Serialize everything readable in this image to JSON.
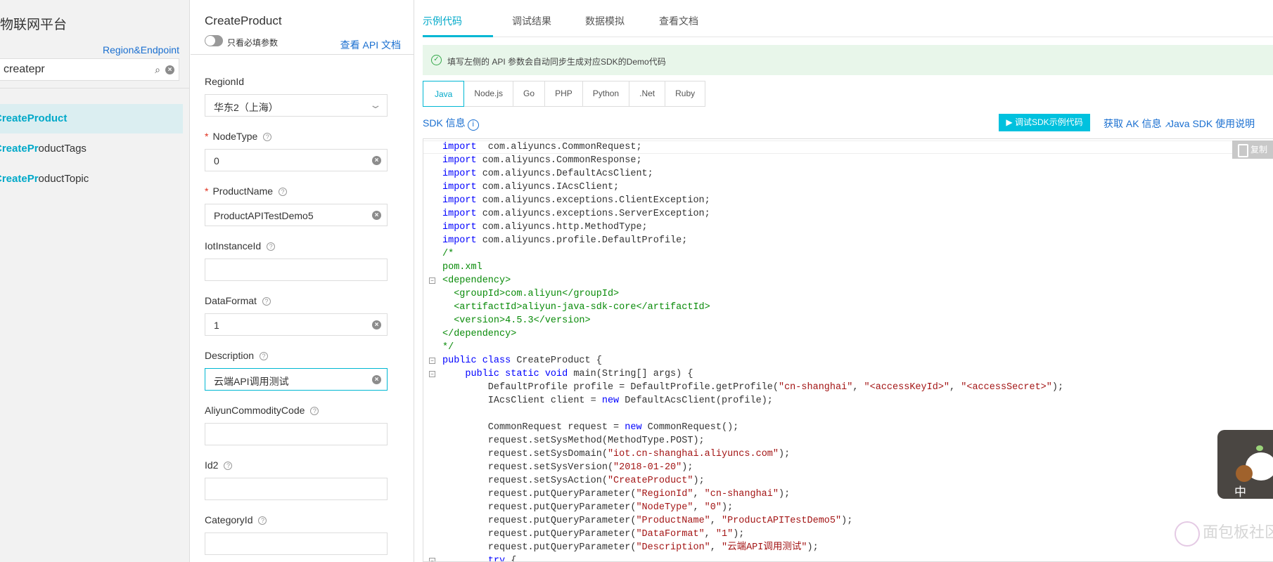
{
  "sidebar": {
    "title": "物联网平台",
    "region_link": "Region&Endpoint",
    "search": {
      "value": "createpr",
      "icons": [
        "search-icon",
        "clear-icon"
      ]
    },
    "items": [
      {
        "highlight": "CreatePr",
        "rest": "oduct",
        "selected": true
      },
      {
        "highlight": "CreatePr",
        "rest": "oductTags",
        "selected": false
      },
      {
        "highlight": "CreatePr",
        "rest": "oductTopic",
        "selected": false
      }
    ]
  },
  "form": {
    "title": "CreateProduct",
    "toggle_label": "只看必填参数",
    "toggle_on": false,
    "api_doc_link": "查看 API 文档",
    "fields": [
      {
        "label": "RegionId",
        "required": false,
        "help": false,
        "type": "select",
        "value": "华东2（上海）"
      },
      {
        "label": "NodeType",
        "required": true,
        "help": true,
        "type": "input",
        "value": "0"
      },
      {
        "label": "ProductName",
        "required": true,
        "help": true,
        "type": "input",
        "value": "ProductAPITestDemo5"
      },
      {
        "label": "IotInstanceId",
        "required": false,
        "help": true,
        "type": "input",
        "value": ""
      },
      {
        "label": "DataFormat",
        "required": false,
        "help": true,
        "type": "input",
        "value": "1"
      },
      {
        "label": "Description",
        "required": false,
        "help": true,
        "type": "input",
        "value": "云端API调用测试",
        "focused": true
      },
      {
        "label": "AliyunCommodityCode",
        "required": false,
        "help": true,
        "type": "input",
        "value": ""
      },
      {
        "label": "Id2",
        "required": false,
        "help": true,
        "type": "input",
        "value": ""
      },
      {
        "label": "CategoryId",
        "required": false,
        "help": true,
        "type": "input",
        "value": ""
      }
    ]
  },
  "main": {
    "tabs": [
      {
        "label": "示例代码",
        "active": true
      },
      {
        "label": "调试结果",
        "active": false
      },
      {
        "label": "数据模拟",
        "active": false
      },
      {
        "label": "查看文档",
        "active": false
      }
    ],
    "banner": "填写左侧的 API 参数会自动同步生成对应SDK的Demo代码",
    "languages": [
      {
        "label": "Java",
        "active": true
      },
      {
        "label": "Node.js"
      },
      {
        "label": "Go"
      },
      {
        "label": "PHP"
      },
      {
        "label": "Python"
      },
      {
        "label": ".Net"
      },
      {
        "label": "Ruby"
      }
    ],
    "sdk_info": "SDK 信息",
    "run_button": "调试SDK示例代码",
    "get_ak": "获取 AK 信息",
    "java_sdk_doc": "Java SDK 使用说明",
    "copy_button": "复制",
    "code": [
      {
        "seg": [
          [
            "kw",
            "import"
          ],
          [
            "",
            "  com.aliyuncs.CommonRequest;"
          ]
        ]
      },
      {
        "seg": [
          [
            "kw",
            "import"
          ],
          [
            "",
            " com.aliyuncs.CommonResponse;"
          ]
        ]
      },
      {
        "seg": [
          [
            "kw",
            "import"
          ],
          [
            "",
            " com.aliyuncs.DefaultAcsClient;"
          ]
        ]
      },
      {
        "seg": [
          [
            "kw",
            "import"
          ],
          [
            "",
            " com.aliyuncs.IAcsClient;"
          ]
        ]
      },
      {
        "seg": [
          [
            "kw",
            "import"
          ],
          [
            "",
            " com.aliyuncs.exceptions.ClientException;"
          ]
        ]
      },
      {
        "seg": [
          [
            "kw",
            "import"
          ],
          [
            "",
            " com.aliyuncs.exceptions.ServerException;"
          ]
        ]
      },
      {
        "seg": [
          [
            "kw",
            "import"
          ],
          [
            "",
            " com.aliyuncs.http.MethodType;"
          ]
        ]
      },
      {
        "seg": [
          [
            "kw",
            "import"
          ],
          [
            "",
            " com.aliyuncs.profile.DefaultProfile;"
          ]
        ]
      },
      {
        "seg": [
          [
            "xml",
            "/*"
          ]
        ]
      },
      {
        "seg": [
          [
            "xml",
            "pom.xml"
          ]
        ]
      },
      {
        "seg": [
          [
            "xml",
            "<dependency>"
          ]
        ],
        "fold": true
      },
      {
        "seg": [
          [
            "xml",
            "  <groupId>com.aliyun</groupId>"
          ]
        ]
      },
      {
        "seg": [
          [
            "xml",
            "  <artifactId>aliyun-java-sdk-core</artifactId>"
          ]
        ]
      },
      {
        "seg": [
          [
            "xml",
            "  <version>4.5.3</version>"
          ]
        ]
      },
      {
        "seg": [
          [
            "xml",
            "</dependency>"
          ]
        ]
      },
      {
        "seg": [
          [
            "xml",
            "*/"
          ]
        ]
      },
      {
        "seg": [
          [
            "kw",
            "public class"
          ],
          [
            "",
            " CreateProduct {"
          ]
        ],
        "fold": true
      },
      {
        "seg": [
          [
            "",
            "    "
          ],
          [
            "kw",
            "public static void"
          ],
          [
            "",
            " main(String[] args) {"
          ]
        ],
        "fold": true
      },
      {
        "seg": [
          [
            "",
            "        DefaultProfile profile = DefaultProfile.getProfile("
          ],
          [
            "str",
            "\"cn-shanghai\""
          ],
          [
            "",
            ", "
          ],
          [
            "str",
            "\"<accessKeyId>\""
          ],
          [
            "",
            ", "
          ],
          [
            "str",
            "\"<accessSecret>\""
          ],
          [
            "",
            ");"
          ]
        ]
      },
      {
        "seg": [
          [
            "",
            "        IAcsClient client = "
          ],
          [
            "kw",
            "new"
          ],
          [
            "",
            " DefaultAcsClient(profile);"
          ]
        ]
      },
      {
        "seg": [
          [
            "",
            ""
          ]
        ]
      },
      {
        "seg": [
          [
            "",
            "        CommonRequest request = "
          ],
          [
            "kw",
            "new"
          ],
          [
            "",
            " CommonRequest();"
          ]
        ]
      },
      {
        "seg": [
          [
            "",
            "        request.setSysMethod(MethodType.POST);"
          ]
        ]
      },
      {
        "seg": [
          [
            "",
            "        request.setSysDomain("
          ],
          [
            "str",
            "\"iot.cn-shanghai.aliyuncs.com\""
          ],
          [
            "",
            ");"
          ]
        ]
      },
      {
        "seg": [
          [
            "",
            "        request.setSysVersion("
          ],
          [
            "str",
            "\"2018-01-20\""
          ],
          [
            "",
            ");"
          ]
        ]
      },
      {
        "seg": [
          [
            "",
            "        request.setSysAction("
          ],
          [
            "str",
            "\"CreateProduct\""
          ],
          [
            "",
            ");"
          ]
        ]
      },
      {
        "seg": [
          [
            "",
            "        request.putQueryParameter("
          ],
          [
            "str",
            "\"RegionId\""
          ],
          [
            "",
            ", "
          ],
          [
            "str",
            "\"cn-shanghai\""
          ],
          [
            "",
            ");"
          ]
        ]
      },
      {
        "seg": [
          [
            "",
            "        request.putQueryParameter("
          ],
          [
            "str",
            "\"NodeType\""
          ],
          [
            "",
            ", "
          ],
          [
            "str",
            "\"0\""
          ],
          [
            "",
            ");"
          ]
        ]
      },
      {
        "seg": [
          [
            "",
            "        request.putQueryParameter("
          ],
          [
            "str",
            "\"ProductName\""
          ],
          [
            "",
            ", "
          ],
          [
            "str",
            "\"ProductAPITestDemo5\""
          ],
          [
            "",
            ");"
          ]
        ]
      },
      {
        "seg": [
          [
            "",
            "        request.putQueryParameter("
          ],
          [
            "str",
            "\"DataFormat\""
          ],
          [
            "",
            ", "
          ],
          [
            "str",
            "\"1\""
          ],
          [
            "",
            ");"
          ]
        ]
      },
      {
        "seg": [
          [
            "",
            "        request.putQueryParameter("
          ],
          [
            "str",
            "\"Description\""
          ],
          [
            "",
            ", "
          ],
          [
            "str",
            "\"云端API调用测试\""
          ],
          [
            "",
            ");"
          ]
        ]
      },
      {
        "seg": [
          [
            "",
            "        "
          ],
          [
            "kw",
            "try"
          ],
          [
            "",
            " {"
          ]
        ],
        "fold": true
      }
    ],
    "widget_text": "中",
    "watermark": "面包板社区"
  },
  "colors": {
    "accent": "#00b7d3",
    "link": "#1a6fd0",
    "required": "#e0301e",
    "banner_bg": "#e8f6ea",
    "keyword": "#0000ff",
    "string": "#a31515",
    "comment": "#098b09"
  }
}
